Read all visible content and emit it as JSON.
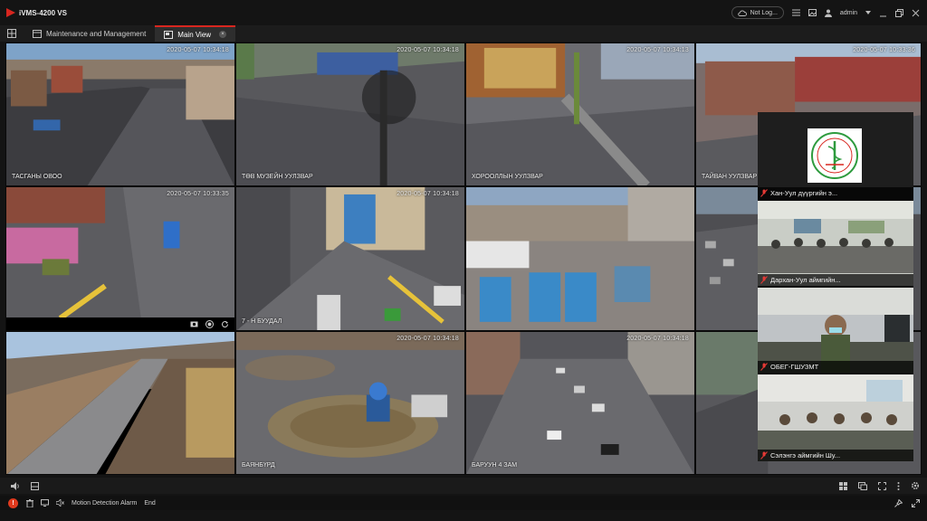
{
  "app": {
    "title": "iVMS-4200 VS",
    "login_status": "Not Log...",
    "user": "admin"
  },
  "tabs": [
    {
      "label": "Maintenance and Management",
      "active": false
    },
    {
      "label": "Main View",
      "active": true
    }
  ],
  "cameras": [
    {
      "timestamp": "2020-05-07 10:34:18",
      "name": "ТАСГАНЫ ОВОО"
    },
    {
      "timestamp": "2020-05-07 10:34:18",
      "name": "ТӨВ МУЗЕЙН УУЛЗВАР"
    },
    {
      "timestamp": "2020-05-07 10:34:13",
      "name": "ХОРООЛЛЫН УУЛЗВАР"
    },
    {
      "timestamp": "2020-05-07 10:33:36",
      "name": "ТАЙВАН УУЛЗВАР"
    },
    {
      "timestamp": "2020-05-07 10:33:35",
      "name": ""
    },
    {
      "timestamp": "2020-05-07 10:34:18",
      "name": "7 - Н БУУДАЛ"
    },
    {
      "timestamp": "",
      "name": ""
    },
    {
      "timestamp": "",
      "name": ""
    },
    {
      "timestamp": "",
      "name": ""
    },
    {
      "timestamp": "2020-05-07 10:34:18",
      "name": "БАЯНБҮРД"
    },
    {
      "timestamp": "2020-05-07 10:34:18",
      "name": "БАРУУН 4 ЗАМ"
    }
  ],
  "conference": [
    {
      "name": "Хан-Уул дүүргийн э..."
    },
    {
      "name": "Дархан-Уул аймгийн..."
    },
    {
      "name": "ОБЕГ-ГШУЗМТ"
    },
    {
      "name": "Сэлэнгэ аймгийн Шу..."
    }
  ],
  "logo": {
    "ring_text": "ХАН-УУЛ ДҮҮРГИЙН ЭРҮҮЛ МЭНДИЙН ТӨВ"
  },
  "statusbar": {
    "alarm_label": "!",
    "text": "Motion Detection Alarm",
    "end": "End"
  },
  "colors": {
    "accent": "#d8261f",
    "bg": "#141414",
    "alarm": "#e03a1e",
    "logo_green": "#2e9b3e"
  },
  "icons": {
    "titlebar": [
      "cloud-icon",
      "list-icon",
      "image-icon",
      "user-icon",
      "minimize-icon",
      "restore-icon",
      "close-icon"
    ],
    "gridbar_left": [
      "volume-icon",
      "panel-icon"
    ],
    "gridbar_right": [
      "layout-icon",
      "window-icon",
      "fullscreen-icon",
      "more-icon",
      "settings-icon"
    ],
    "status_right": [
      "pin-icon",
      "expand-icon"
    ]
  }
}
